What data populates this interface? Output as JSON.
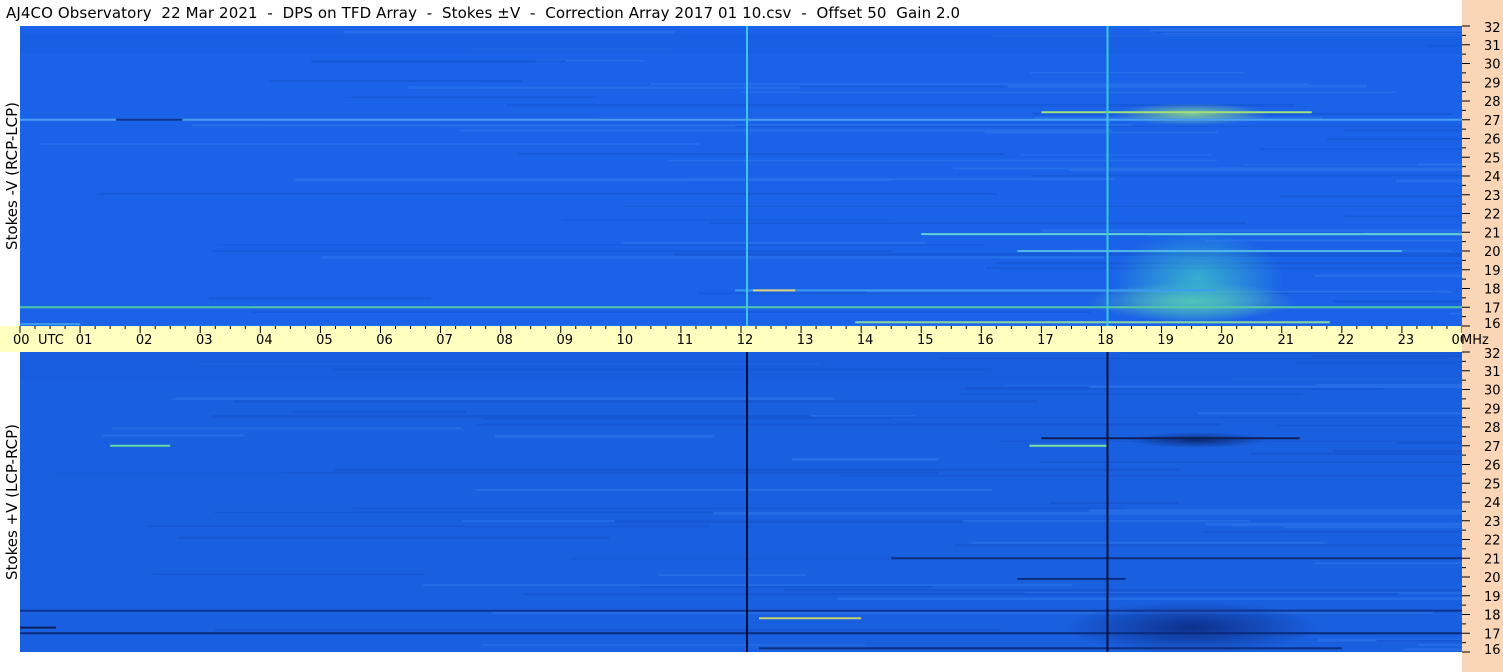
{
  "chart_data": {
    "type": "heatmap",
    "title": "AJ4CO Observatory  22 Mar 2021  -  DPS on TFD Array  -  Stokes ±V  -  Correction Array 2017 01 10.csv  -  Offset 50  Gain 2.0",
    "x_axis": {
      "unit_label": "UTC",
      "ticks": [
        "00",
        "01",
        "02",
        "03",
        "04",
        "05",
        "06",
        "07",
        "08",
        "09",
        "10",
        "11",
        "12",
        "13",
        "14",
        "15",
        "16",
        "17",
        "18",
        "19",
        "20",
        "21",
        "22",
        "23",
        "00"
      ],
      "range": [
        0,
        24
      ]
    },
    "y_axis": {
      "unit_label": "MHz",
      "ticks": [
        "16",
        "17",
        "18",
        "19",
        "20",
        "21",
        "22",
        "23",
        "24",
        "25",
        "26",
        "27",
        "28",
        "29",
        "30",
        "31",
        "32"
      ],
      "range": [
        16,
        32
      ]
    },
    "panels": [
      {
        "label": "Stokes -V (RCP-LCP)",
        "background": "#1a63e8",
        "vertical_markers": [
          {
            "time_hours": 12.1,
            "color": "#3cc8e0"
          },
          {
            "time_hours": 18.1,
            "color": "#3cc8e0"
          }
        ],
        "features": [
          {
            "kind": "line",
            "freq_mhz": 17.0,
            "t0": 0.0,
            "t1": 24.0,
            "color": "#55c8a8"
          },
          {
            "kind": "line",
            "freq_mhz": 16.2,
            "t0": 13.9,
            "t1": 21.8,
            "color": "#8ad6a0"
          },
          {
            "kind": "line",
            "freq_mhz": 17.9,
            "t0": 11.9,
            "t1": 19.9,
            "color": "#3a9df0"
          },
          {
            "kind": "line",
            "freq_mhz": 20.9,
            "t0": 15.0,
            "t1": 24.0,
            "color": "#5fd1d2"
          },
          {
            "kind": "line",
            "freq_mhz": 20.0,
            "t0": 16.6,
            "t1": 23.0,
            "color": "#4fb6e6"
          },
          {
            "kind": "line",
            "freq_mhz": 27.4,
            "t0": 17.0,
            "t1": 21.5,
            "color": "#9fe080"
          },
          {
            "kind": "line",
            "freq_mhz": 27.0,
            "t0": 0.0,
            "t1": 24.0,
            "color": "#4a9ff0"
          },
          {
            "kind": "line",
            "freq_mhz": 27.0,
            "t0": 1.6,
            "t1": 2.7,
            "color": "#0b2f8a"
          },
          {
            "kind": "line",
            "freq_mhz": 17.9,
            "t0": 12.2,
            "t1": 12.9,
            "color": "#e0d080"
          },
          {
            "kind": "line",
            "freq_mhz": 16.1,
            "t0": 0.0,
            "t1": 1.0,
            "color": "#3a9df0"
          },
          {
            "kind": "glow",
            "freq_mhz": 17.3,
            "t_center": 19.5,
            "t_width": 2.4,
            "f_width": 1.5,
            "color": "#70e0a0"
          },
          {
            "kind": "glow",
            "freq_mhz": 18.5,
            "t_center": 19.6,
            "t_width": 2.0,
            "f_width": 3.5,
            "color": "#40c8c8"
          },
          {
            "kind": "glow",
            "freq_mhz": 27.3,
            "t_center": 19.5,
            "t_width": 1.8,
            "f_width": 0.8,
            "color": "#a0e880"
          }
        ]
      },
      {
        "label": "Stokes +V (LCP-RCP)",
        "background": "#1960e0",
        "vertical_markers": [
          {
            "time_hours": 12.1,
            "color": "#05103a"
          },
          {
            "time_hours": 18.1,
            "color": "#05103a"
          }
        ],
        "features": [
          {
            "kind": "line",
            "freq_mhz": 17.0,
            "t0": 0.0,
            "t1": 24.0,
            "color": "#0a2a7a"
          },
          {
            "kind": "line",
            "freq_mhz": 17.3,
            "t0": 0.0,
            "t1": 0.6,
            "color": "#0a1f5a"
          },
          {
            "kind": "line",
            "freq_mhz": 16.2,
            "t0": 12.3,
            "t1": 22.0,
            "color": "#102e80"
          },
          {
            "kind": "line",
            "freq_mhz": 17.8,
            "t0": 12.3,
            "t1": 14.0,
            "color": "#c8d070"
          },
          {
            "kind": "line",
            "freq_mhz": 18.2,
            "t0": 0.0,
            "t1": 24.0,
            "color": "#0f3590"
          },
          {
            "kind": "line",
            "freq_mhz": 21.0,
            "t0": 14.5,
            "t1": 24.0,
            "color": "#0d2c80"
          },
          {
            "kind": "line",
            "freq_mhz": 19.9,
            "t0": 16.6,
            "t1": 18.4,
            "color": "#0d2c80"
          },
          {
            "kind": "line",
            "freq_mhz": 27.4,
            "t0": 17.0,
            "t1": 21.3,
            "color": "#0b1f5a"
          },
          {
            "kind": "line",
            "freq_mhz": 27.0,
            "t0": 1.5,
            "t1": 2.5,
            "color": "#60d8a0"
          },
          {
            "kind": "line",
            "freq_mhz": 27.0,
            "t0": 16.8,
            "t1": 18.1,
            "color": "#7fe0a0"
          },
          {
            "kind": "glow",
            "freq_mhz": 17.3,
            "t_center": 19.5,
            "t_width": 3.0,
            "f_width": 2.0,
            "color": "#0a2070"
          },
          {
            "kind": "glow",
            "freq_mhz": 27.3,
            "t_center": 19.6,
            "t_width": 1.6,
            "f_width": 0.6,
            "color": "#081a55"
          }
        ]
      }
    ],
    "grid": false,
    "colors": {
      "time_axis_bg": "#ffffc0",
      "freq_axis_bg": "#fbd6b6"
    }
  }
}
